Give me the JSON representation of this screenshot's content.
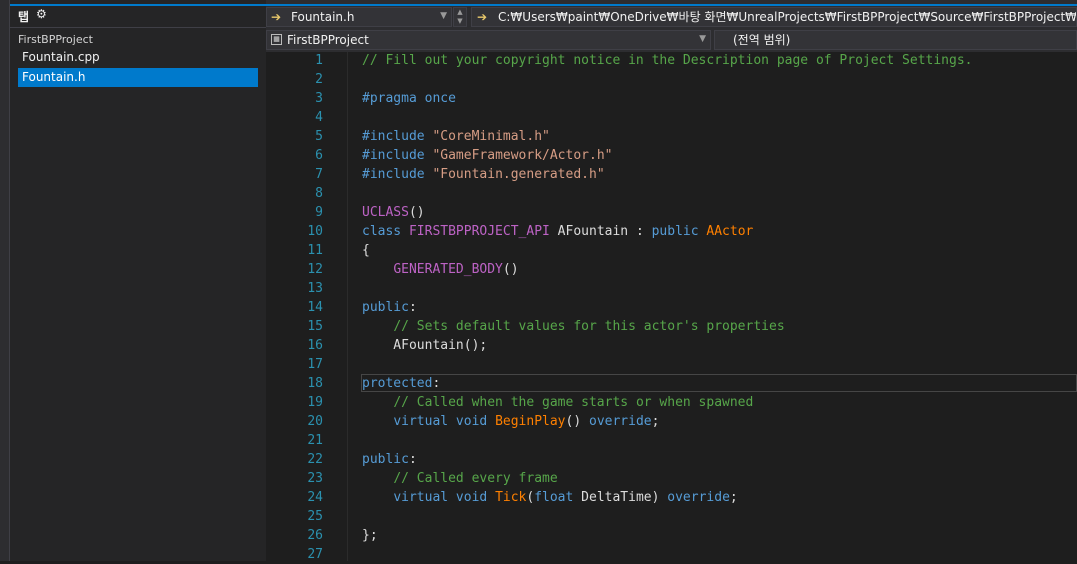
{
  "solution_panel": {
    "tab_label": "탭",
    "gear_icon": "gear-icon",
    "project_name": "FirstBPProject",
    "files": [
      "Fountain.cpp",
      "Fountain.h"
    ],
    "selected_file": "Fountain.h"
  },
  "navbar": {
    "file_combo": "Fountain.h",
    "path": "C:₩Users₩paint₩OneDrive₩바탕 화면₩UnrealProjects₩FirstBPProject₩Source₩FirstBPProject₩Fountain.h",
    "project_combo": "FirstBPProject",
    "scope_combo": "(전역 범위)"
  },
  "editor": {
    "line_numbers": [
      "1",
      "2",
      "3",
      "4",
      "5",
      "6",
      "7",
      "8",
      "9",
      "10",
      "11",
      "12",
      "13",
      "14",
      "15",
      "16",
      "17",
      "18",
      "19",
      "20",
      "21",
      "22",
      "23",
      "24",
      "25",
      "26",
      "27"
    ],
    "lines": [
      [
        [
          "// Fill out your copyright notice in the Description page of Project Settings.",
          "cmt"
        ]
      ],
      [],
      [
        [
          "#pragma once",
          "pp2"
        ]
      ],
      [],
      [
        [
          "#include ",
          "pp"
        ],
        [
          "\"CoreMinimal.h\"",
          "str"
        ]
      ],
      [
        [
          "#include ",
          "pp"
        ],
        [
          "\"GameFramework/Actor.h\"",
          "str"
        ]
      ],
      [
        [
          "#include ",
          "pp"
        ],
        [
          "\"Fountain.generated.h\"",
          "str"
        ]
      ],
      [],
      [
        [
          "UCLASS",
          "mac"
        ],
        [
          "()",
          "txt"
        ]
      ],
      [
        [
          "class ",
          "kw"
        ],
        [
          "FIRSTBPPROJECT_API",
          "mac"
        ],
        [
          " AFountain : ",
          "txt"
        ],
        [
          "public ",
          "kw"
        ],
        [
          "AActor",
          "cls"
        ]
      ],
      [
        [
          "{",
          "txt"
        ]
      ],
      [
        [
          "    ",
          "txt"
        ],
        [
          "GENERATED_BODY",
          "mac"
        ],
        [
          "()",
          "txt"
        ]
      ],
      [],
      [
        [
          "public",
          "kw"
        ],
        [
          ":",
          "txt"
        ]
      ],
      [
        [
          "    ",
          "txt"
        ],
        [
          "// Sets default values for this actor's properties",
          "cmt"
        ]
      ],
      [
        [
          "    AFountain();",
          "txt"
        ]
      ],
      [],
      [
        [
          "protected",
          "kw"
        ],
        [
          ":",
          "txt"
        ]
      ],
      [
        [
          "    ",
          "txt"
        ],
        [
          "// Called when the game starts or when spawned",
          "cmt"
        ]
      ],
      [
        [
          "    ",
          "txt"
        ],
        [
          "virtual void ",
          "kw"
        ],
        [
          "BeginPlay",
          "cls"
        ],
        [
          "() ",
          "txt"
        ],
        [
          "override",
          "kw"
        ],
        [
          ";",
          "txt"
        ]
      ],
      [],
      [
        [
          "public",
          "kw"
        ],
        [
          ":",
          "txt"
        ]
      ],
      [
        [
          "    ",
          "txt"
        ],
        [
          "// Called every frame",
          "cmt"
        ]
      ],
      [
        [
          "    ",
          "txt"
        ],
        [
          "virtual void ",
          "kw"
        ],
        [
          "Tick",
          "cls"
        ],
        [
          "(",
          "txt"
        ],
        [
          "float ",
          "kw"
        ],
        [
          "DeltaTime",
          "txt"
        ],
        [
          ") ",
          "txt"
        ],
        [
          "override",
          "kw"
        ],
        [
          ";",
          "txt"
        ]
      ],
      [],
      [
        [
          "};",
          "txt"
        ]
      ],
      []
    ],
    "current_line": 18
  },
  "colors": {
    "accent": "#007acc",
    "comment": "#57a64a",
    "keyword": "#569cd6",
    "string": "#d69d85",
    "macro": "#bd63c5",
    "function": "#ff8000",
    "line_number": "#2b91af"
  }
}
